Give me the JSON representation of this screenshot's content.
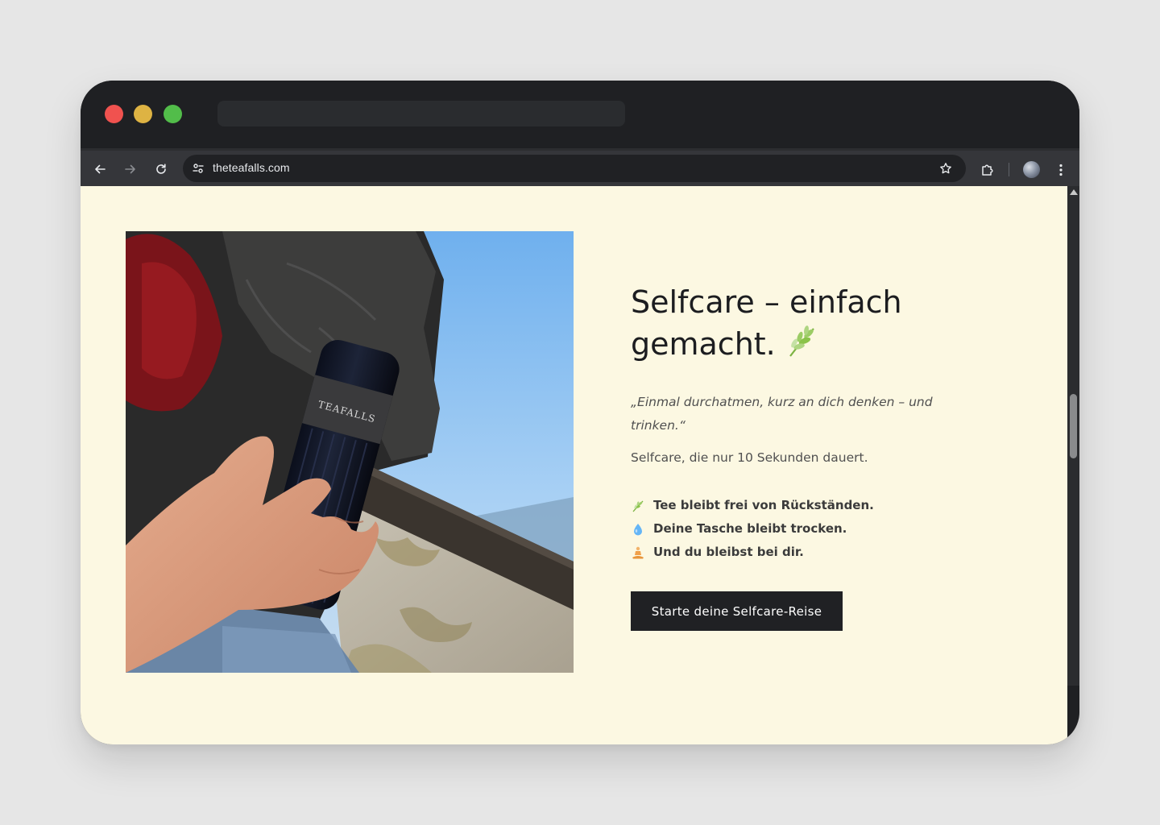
{
  "browser": {
    "url": "theteafalls.com"
  },
  "hero": {
    "headline_line1": "Selfcare – einfach",
    "headline_line2": "gemacht.",
    "headline_icon": "herb-icon",
    "quote_line1": "„Einmal durchatmen, kurz an dich denken – und",
    "quote_line2": "trinken.“",
    "subtext": "Selfcare, die nur 10 Sekunden dauert.",
    "benefits": [
      {
        "icon": "herb-icon",
        "text": "Tee bleibt frei von Rückständen."
      },
      {
        "icon": "droplet-icon",
        "text": "Deine Tasche bleibt trocken."
      },
      {
        "icon": "meditation-icon",
        "text": "Und du bleibst bei dir."
      }
    ],
    "cta_label": "Starte deine Selfcare-Reise",
    "bottle_brand": "TEAFALLS"
  },
  "colors": {
    "page_background": "#fcf8e2",
    "button_background": "#202124",
    "heading": "#1c1d20",
    "body_text": "#505050"
  }
}
